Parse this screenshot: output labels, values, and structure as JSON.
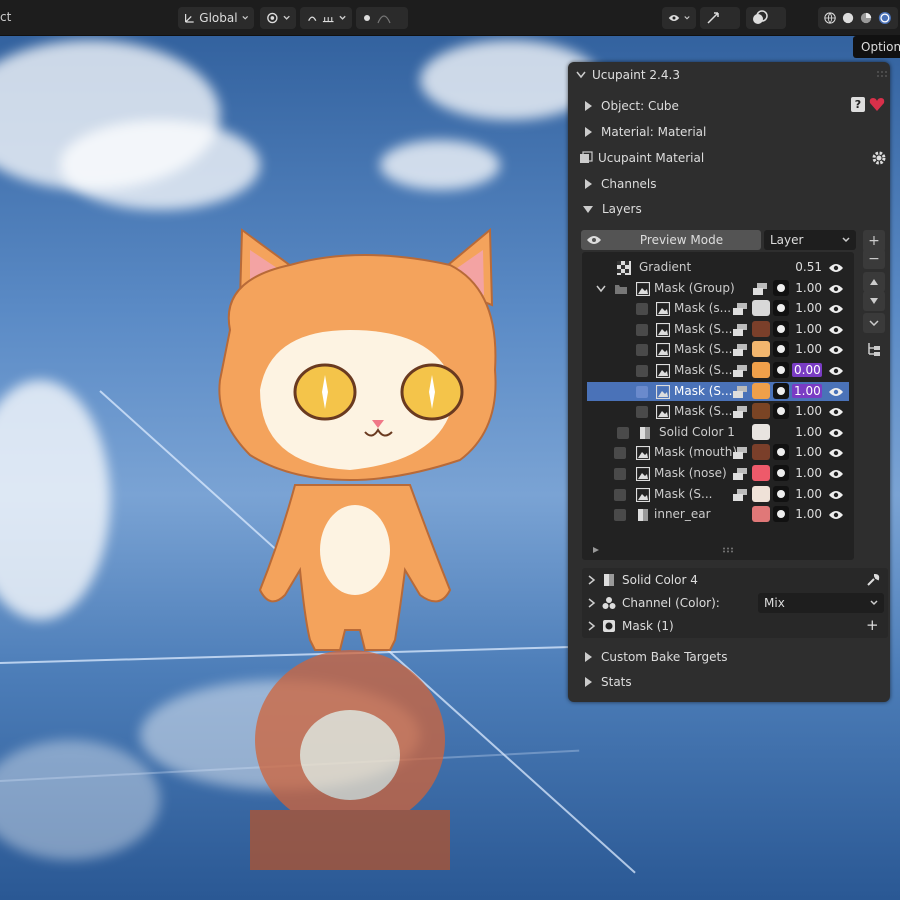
{
  "header": {
    "left_fragment": "ct",
    "orientation_label": "Global",
    "tooltip": "Options"
  },
  "panel": {
    "title": "Ucupaint 2.4.3",
    "object_label": "Object: Cube",
    "material_label": "Material: Material",
    "ucupaint_material_label": "Ucupaint Material",
    "channels_label": "Channels",
    "layers_label": "Layers",
    "preview_mode_label": "Preview Mode",
    "layer_select": "Layer",
    "layers": [
      {
        "name": "Gradient",
        "value": "0.51",
        "indent": 0,
        "type": "gradient",
        "swatch": ""
      },
      {
        "name": "Mask (Group)",
        "value": "1.00",
        "indent": 0,
        "type": "group",
        "swatch": ""
      },
      {
        "name": "Mask (s...",
        "value": "1.00",
        "indent": 1,
        "type": "image",
        "swatch": "#d8d8d8"
      },
      {
        "name": "Mask (S...",
        "value": "1.00",
        "indent": 1,
        "type": "image",
        "swatch": "#7a3f2a"
      },
      {
        "name": "Mask (S...",
        "value": "1.00",
        "indent": 1,
        "type": "image",
        "swatch": "#f2b66e"
      },
      {
        "name": "Mask (S...",
        "value": "0.00",
        "indent": 1,
        "type": "image",
        "swatch": "#f0a04a"
      },
      {
        "name": "Mask (S...",
        "value": "1.00",
        "indent": 1,
        "type": "image",
        "swatch": "#f0a04a"
      },
      {
        "name": "Mask (S...",
        "value": "1.00",
        "indent": 1,
        "type": "image",
        "swatch": "#7a4424"
      },
      {
        "name": "Solid Color 1",
        "value": "1.00",
        "indent": 1,
        "type": "solid",
        "swatch": "#e8e4e0"
      },
      {
        "name": "Mask (mouth)",
        "value": "1.00",
        "indent": 0,
        "type": "image",
        "swatch": "#7a3f2a"
      },
      {
        "name": "Mask (nose)",
        "value": "1.00",
        "indent": 0,
        "type": "image",
        "swatch": "#ee5a6a"
      },
      {
        "name": "Mask (S...",
        "value": "1.00",
        "indent": 0,
        "type": "image",
        "swatch": "#efe2d8"
      },
      {
        "name": "inner_ear",
        "value": "1.00",
        "indent": 0,
        "type": "solid",
        "swatch": "#e07878"
      }
    ],
    "solid_color_label": "Solid Color 4",
    "channel_color_label": "Channel (Color):",
    "channel_blend": "Mix",
    "mask_label": "Mask (1)",
    "custom_bake_label": "Custom Bake Targets",
    "stats_label": "Stats"
  },
  "colors": {
    "selection": "#4a72b8",
    "purple_value": "#7a3cc4",
    "panel_bg": "#2e2e2e"
  }
}
